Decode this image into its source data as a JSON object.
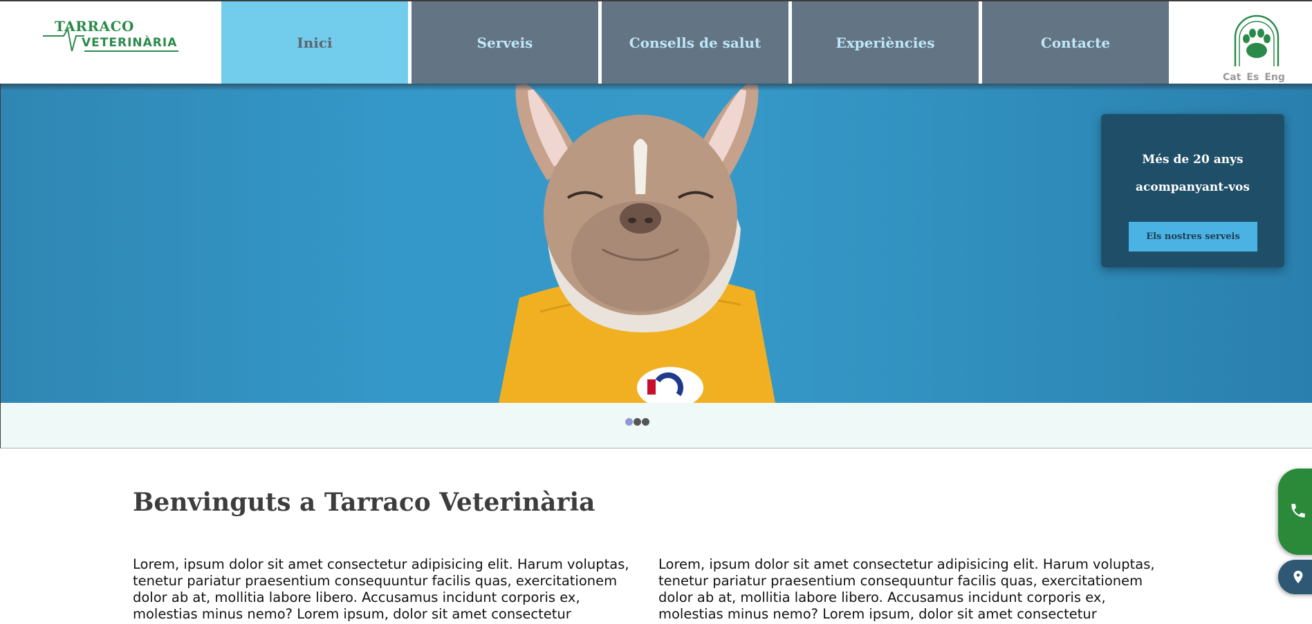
{
  "logo": {
    "line1": "TARRACO",
    "line2": "VETERINÀRIA",
    "color": "#2b8a4a"
  },
  "nav": {
    "items": [
      {
        "label": "Inici",
        "active": true
      },
      {
        "label": "Serveis",
        "active": false
      },
      {
        "label": "Consells de salut",
        "active": false
      },
      {
        "label": "Experiències",
        "active": false
      },
      {
        "label": "Contacte",
        "active": false
      }
    ]
  },
  "badge": {
    "icon": "paw-icon"
  },
  "languages": [
    "Cat",
    "Es",
    "Eng"
  ],
  "hero": {
    "image": "dog-photo",
    "cta": {
      "line1": "Més de 20 anys",
      "line2": "acompanyant-vos",
      "button": "Els nostres serveis"
    }
  },
  "carousel": {
    "active_index": 0,
    "count": 3
  },
  "main": {
    "title": "Benvinguts a Tarraco Veterinària",
    "col1": "Lorem, ipsum dolor sit amet consectetur adipisicing elit. Harum voluptas, tenetur pariatur praesentium consequuntur facilis quas, exercitationem dolor ab at, mollitia labore libero. Accusamus incidunt corporis ex, molestias minus nemo? Lorem ipsum, dolor sit amet consectetur",
    "col2": "Lorem, ipsum dolor sit amet consectetur adipisicing elit. Harum voluptas, tenetur pariatur praesentium consequuntur facilis quas, exercitationem dolor ab at, mollitia labore libero. Accusamus incidunt corporis ex, molestias minus nemo? Lorem ipsum, dolor sit amet consectetur"
  },
  "floating": {
    "phone_icon": "phone-icon",
    "location_icon": "location-pin-icon"
  },
  "colors": {
    "nav": "#637485",
    "nav_active": "#72cdec",
    "hero_bg": "#3498c8",
    "cta_bg": "#1f4f68",
    "cta_button": "#4ab3e3"
  }
}
